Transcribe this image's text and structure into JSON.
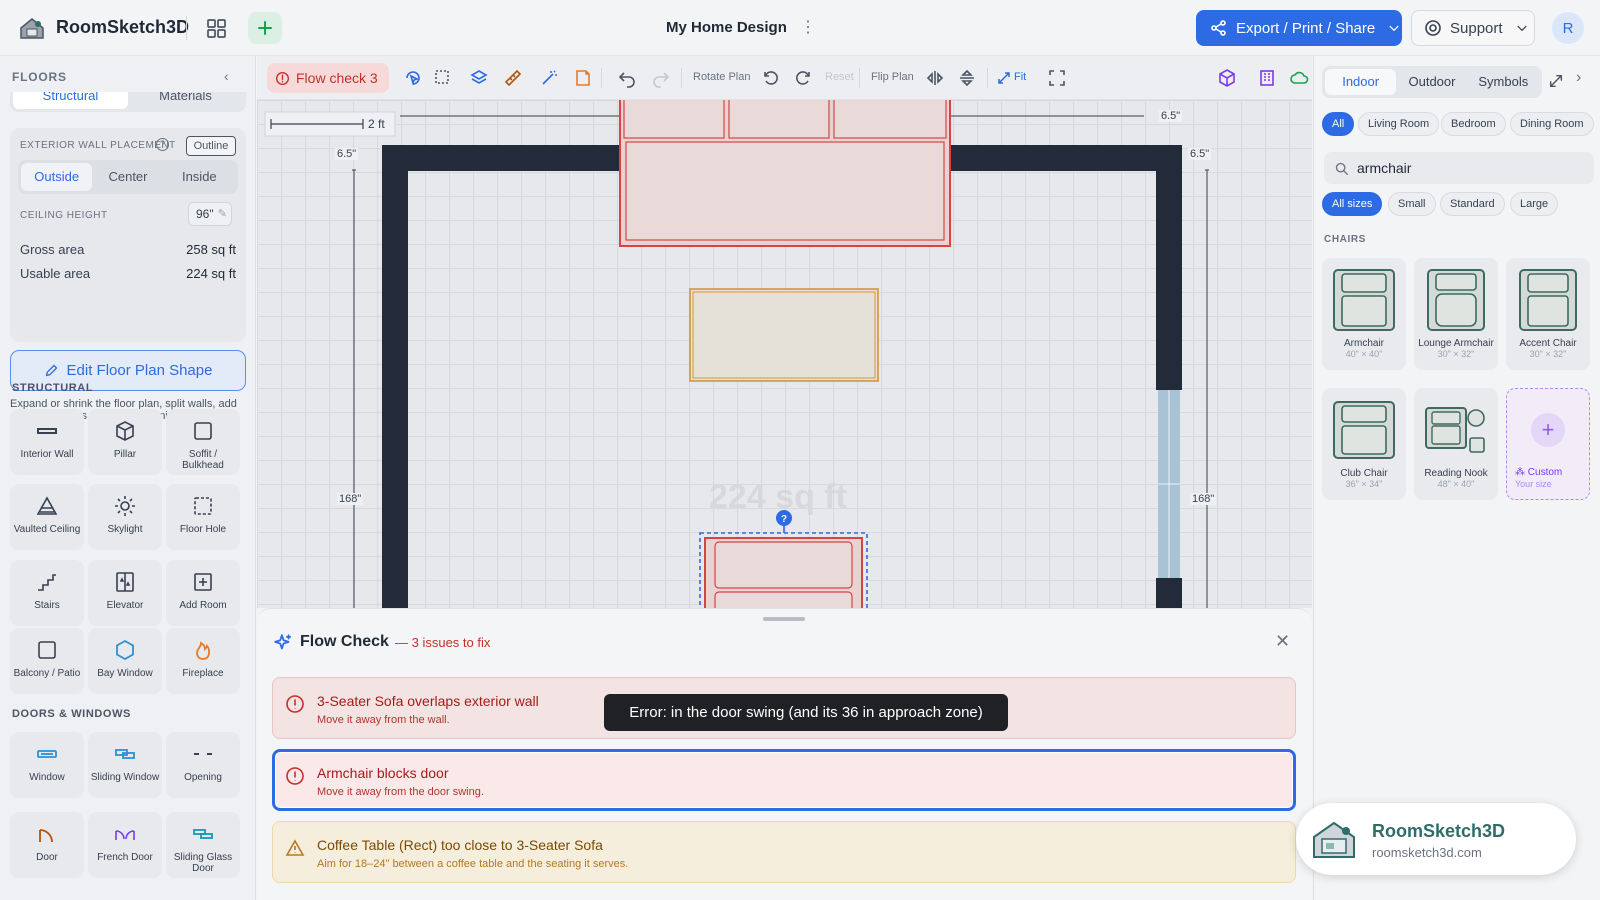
{
  "app": {
    "name": "RoomSketch3D",
    "doc_title": "My Home Design"
  },
  "header": {
    "export_label": "Export / Print / Share",
    "support_label": "Support",
    "avatar_initial": "R"
  },
  "sidebar": {
    "floors_title": "FLOORS",
    "top_tabs": [
      "Structural",
      "Materials"
    ],
    "exterior_wall_label": "EXTERIOR WALL PLACEMENT",
    "outline_label": "Outline",
    "placement_options": [
      "Outside",
      "Center",
      "Inside"
    ],
    "ceiling_label": "CEILING HEIGHT",
    "ceiling_value": "96\"",
    "gross_label": "Gross area",
    "gross_value": "258 sq ft",
    "usable_label": "Usable area",
    "usable_value": "224 sq ft",
    "edit_shape_label": "Edit Floor Plan Shape",
    "edit_shape_desc": "Expand or shrink the floor plan, split walls, add or remove walls, and add adjoining rooms or spaces.",
    "structural_title": "STRUCTURAL",
    "structural_tools": [
      "Interior Wall",
      "Pillar",
      "Soffit / Bulkhead",
      "Vaulted Ceiling",
      "Skylight",
      "Floor Hole",
      "Stairs",
      "Elevator",
      "Add Room",
      "Balcony / Patio",
      "Bay Window",
      "Fireplace"
    ],
    "doors_title": "DOORS & WINDOWS",
    "door_tools": [
      "Window",
      "Sliding Window",
      "Opening",
      "Door",
      "French Door",
      "Sliding Glass Door"
    ]
  },
  "toolbar": {
    "flow_check_label": "Flow check 3",
    "rotate_label": "Rotate Plan",
    "reset_label": "Reset",
    "flip_label": "Flip Plan",
    "fit_label": "Fit"
  },
  "canvas": {
    "scale_label": "2 ft",
    "dims": {
      "top": "6.5\"",
      "left_top": "6.5\"",
      "right_top": "6.5\"",
      "left": "168\"",
      "right": "168\""
    },
    "area_watermark": "224 sq ft"
  },
  "right_panel": {
    "tabs": [
      "Indoor",
      "Outdoor",
      "Symbols"
    ],
    "room_filters": [
      "All",
      "Living Room",
      "Bedroom",
      "Dining Room"
    ],
    "search_value": "armchair",
    "size_filters": [
      "All sizes",
      "Small",
      "Standard",
      "Large"
    ],
    "chairs_title": "CHAIRS",
    "items": [
      {
        "name": "Armchair",
        "dims": "40\" × 40\""
      },
      {
        "name": "Lounge Armchair",
        "dims": "30\" × 32\""
      },
      {
        "name": "Accent Chair",
        "dims": "30\" × 32\""
      },
      {
        "name": "Club Chair",
        "dims": "36\" × 34\""
      },
      {
        "name": "Reading Nook",
        "dims": "48\" × 40\""
      }
    ],
    "custom_label": "Custom",
    "custom_sub": "Your size"
  },
  "flow_check": {
    "title": "Flow Check",
    "count": "— 3 issues to fix",
    "issues": [
      {
        "title": "3-Seater Sofa overlaps exterior wall",
        "sub": "Move it away from the wall."
      },
      {
        "title": "Armchair blocks door",
        "sub": "Move it away from the door swing."
      },
      {
        "title": "Coffee Table (Rect) too close to 3-Seater Sofa",
        "sub": "Aim for 18–24\" between a coffee table and the seating it serves."
      }
    ]
  },
  "tooltip": "Error: in the door swing (and its 36 in approach zone)",
  "promo": {
    "name": "RoomSketch3D",
    "url": "roomsketch3d.com"
  },
  "colors": {
    "accent": "#2d6be4",
    "error": "#c2302a",
    "warning": "#b7791f",
    "wall": "#232b3a"
  }
}
